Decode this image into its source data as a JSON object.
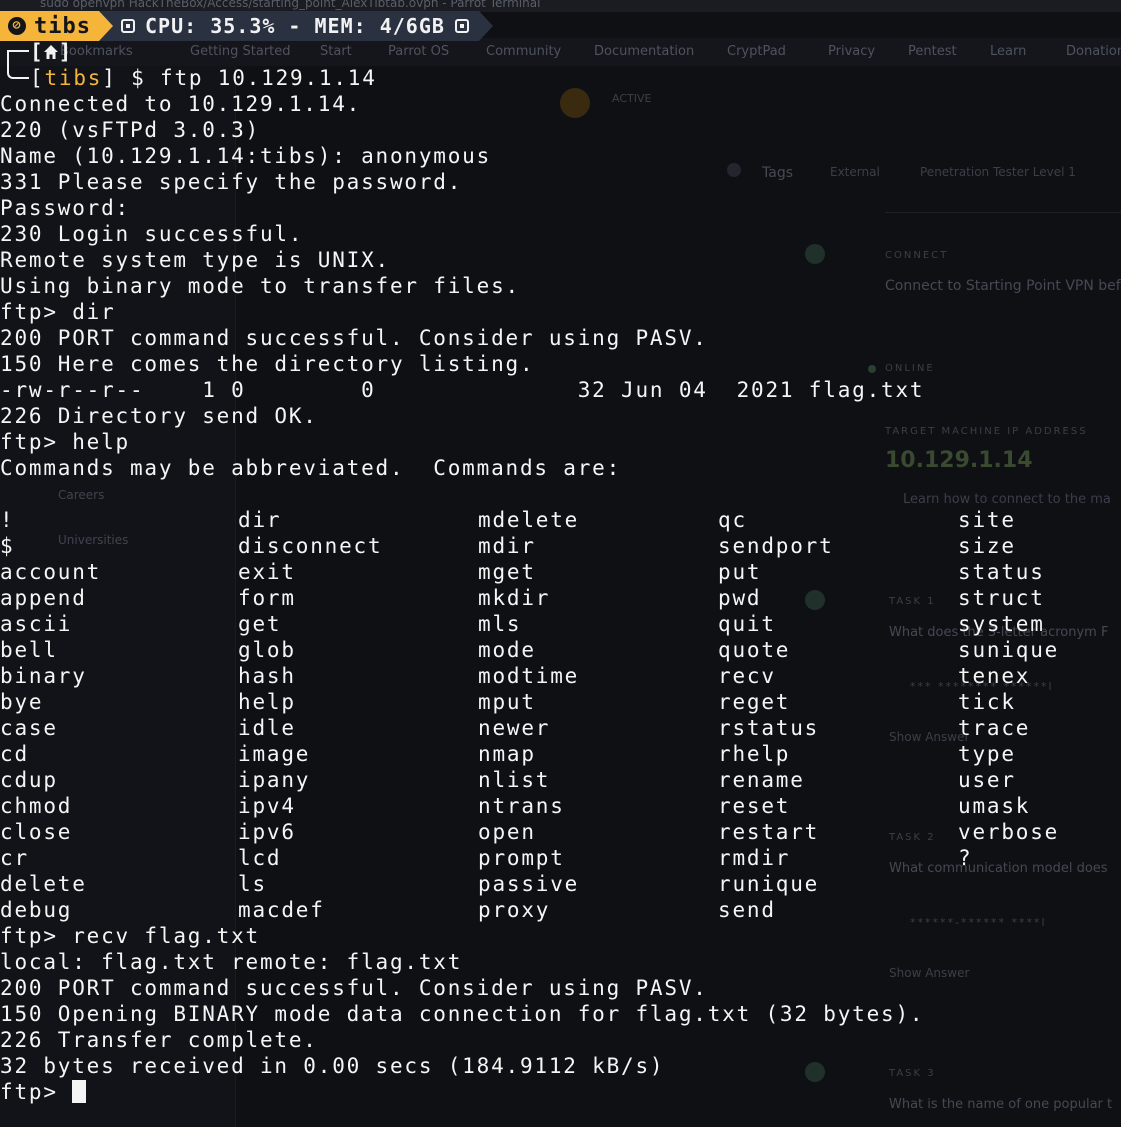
{
  "background_window": {
    "title_text": "sudo openvpn HackTheBox/Access/starting_point_AlexTibtab.ovpn - Parrot Terminal",
    "bookmarks": [
      "Bookmarks",
      "Getting Started",
      "Start",
      "Parrot OS",
      "Community",
      "Documentation",
      "CryptPad",
      "Privacy",
      "Pentest",
      "Learn",
      "Donation"
    ],
    "sidebar_items": [
      "Careers",
      "Universities"
    ],
    "status_badge": "ACTIVE",
    "tags_label": "Tags",
    "tag_external": "External",
    "tag_level": "Penetration Tester Level 1",
    "connect_label": "CONNECT",
    "connect_text": "Connect to Starting Point VPN bef",
    "online_label": "ONLINE",
    "target_label": "TARGET MACHINE IP ADDRESS",
    "target_ip": "10.129.1.14",
    "learn_text": "Learn how to connect to the ma",
    "task1_label": "TASK 1",
    "task1_text": "What does the 3-letter acronym F",
    "task1_answer": "*** ******** ******l",
    "show_answer": "Show Answer",
    "task2_label": "TASK 2",
    "task2_text": "What communication model does",
    "task2_answer": "******-****** ****l",
    "task3_label": "TASK 3",
    "task3_text": "What is the name of one popular t"
  },
  "statusbar": {
    "host": "tibs",
    "info_left": "CPU: 35.3% - MEM: 4/6GB"
  },
  "prompt": {
    "open_bracket": "[",
    "close_bracket": "]",
    "user": "tibs",
    "command": "$ ftp 10.129.1.14"
  },
  "terminal": {
    "lines_top": [
      "Connected to 10.129.1.14.",
      "220 (vsFTPd 3.0.3)",
      "Name (10.129.1.14:tibs): anonymous",
      "331 Please specify the password.",
      "Password:",
      "230 Login successful.",
      "Remote system type is UNIX.",
      "Using binary mode to transfer files.",
      "ftp> dir",
      "200 PORT command successful. Consider using PASV.",
      "150 Here comes the directory listing.",
      "-rw-r--r--    1 0        0              32 Jun 04  2021 flag.txt",
      "226 Directory send OK.",
      "ftp> help",
      "Commands may be abbreviated.  Commands are:"
    ],
    "commands": [
      [
        "!",
        "dir",
        "mdelete",
        "qc",
        "site"
      ],
      [
        "$",
        "disconnect",
        "mdir",
        "sendport",
        "size"
      ],
      [
        "account",
        "exit",
        "mget",
        "put",
        "status"
      ],
      [
        "append",
        "form",
        "mkdir",
        "pwd",
        "struct"
      ],
      [
        "ascii",
        "get",
        "mls",
        "quit",
        "system"
      ],
      [
        "bell",
        "glob",
        "mode",
        "quote",
        "sunique"
      ],
      [
        "binary",
        "hash",
        "modtime",
        "recv",
        "tenex"
      ],
      [
        "bye",
        "help",
        "mput",
        "reget",
        "tick"
      ],
      [
        "case",
        "idle",
        "newer",
        "rstatus",
        "trace"
      ],
      [
        "cd",
        "image",
        "nmap",
        "rhelp",
        "type"
      ],
      [
        "cdup",
        "ipany",
        "nlist",
        "rename",
        "user"
      ],
      [
        "chmod",
        "ipv4",
        "ntrans",
        "reset",
        "umask"
      ],
      [
        "close",
        "ipv6",
        "open",
        "restart",
        "verbose"
      ],
      [
        "cr",
        "lcd",
        "prompt",
        "rmdir",
        "?"
      ],
      [
        "delete",
        "ls",
        "passive",
        "runique",
        ""
      ],
      [
        "debug",
        "macdef",
        "proxy",
        "send",
        ""
      ]
    ],
    "lines_bottom": [
      "ftp> recv flag.txt",
      "local: flag.txt remote: flag.txt",
      "200 PORT command successful. Consider using PASV.",
      "150 Opening BINARY mode data connection for flag.txt (32 bytes).",
      "226 Transfer complete.",
      "32 bytes received in 0.00 secs (184.9112 kB/s)"
    ],
    "final_prompt": "ftp> "
  }
}
